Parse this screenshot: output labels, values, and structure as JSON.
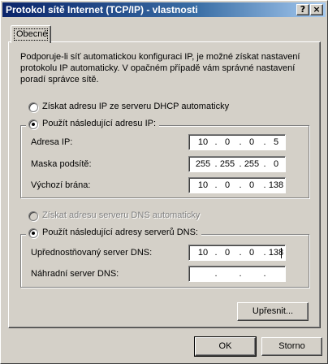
{
  "window": {
    "title": "Protokol sítě Internet (TCP/IP) - vlastnosti",
    "help_button": "?",
    "close_button": "×"
  },
  "tabs": [
    {
      "label": "Obecné"
    }
  ],
  "description": "Podporuje-li síť automatickou konfiguraci IP, je možné získat nastavení protokolu IP automaticky. V opačném případě vám správné nastavení poradí správce sítě.",
  "ip": {
    "auto_option": "Získat adresu IP ze serveru DHCP automaticky",
    "manual_option": "Použít následující adresu IP:",
    "selected": "manual",
    "fields": [
      {
        "label": "Adresa IP:",
        "octets": [
          "10",
          "0",
          "0",
          "5"
        ]
      },
      {
        "label": "Maska podsítě:",
        "octets": [
          "255",
          "255",
          "255",
          "0"
        ]
      },
      {
        "label": "Výchozí brána:",
        "octets": [
          "10",
          "0",
          "0",
          "138"
        ]
      }
    ]
  },
  "dns": {
    "auto_option": "Získat adresu serveru DNS automaticky",
    "auto_disabled": true,
    "manual_option": "Použít následující adresy serverů DNS:",
    "selected": "manual",
    "fields": [
      {
        "label": "Upřednostňovaný server DNS:",
        "octets": [
          "10",
          "0",
          "0",
          "138"
        ]
      },
      {
        "label": "Náhradní server DNS:",
        "octets": [
          "",
          "",
          "",
          ""
        ]
      }
    ]
  },
  "buttons": {
    "advanced": "Upřesnit...",
    "ok": "OK",
    "cancel": "Storno"
  },
  "ip_separator": "."
}
